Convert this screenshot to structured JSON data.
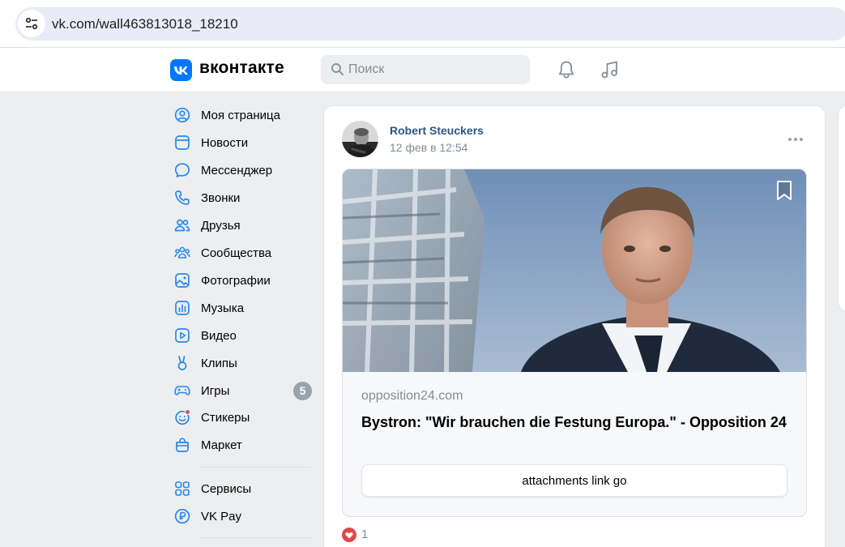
{
  "browser": {
    "url": "vk.com/wall463813018_18210",
    "site_info_icon": "tune-icon"
  },
  "header": {
    "logo_text": "вконтакте",
    "search_placeholder": "Поиск",
    "icons": [
      "bell-icon",
      "music-icon"
    ],
    "accent_color": "#0077ff"
  },
  "sidebar": {
    "items": [
      {
        "label": "Моя страница",
        "icon": "user-circle-icon"
      },
      {
        "label": "Новости",
        "icon": "news-icon"
      },
      {
        "label": "Мессенджер",
        "icon": "message-icon"
      },
      {
        "label": "Звонки",
        "icon": "phone-icon"
      },
      {
        "label": "Друзья",
        "icon": "friends-icon"
      },
      {
        "label": "Сообщества",
        "icon": "communities-icon"
      },
      {
        "label": "Фотографии",
        "icon": "photo-icon"
      },
      {
        "label": "Музыка",
        "icon": "music-note-icon"
      },
      {
        "label": "Видео",
        "icon": "video-icon"
      },
      {
        "label": "Клипы",
        "icon": "clips-icon"
      },
      {
        "label": "Игры",
        "icon": "gamepad-icon",
        "badge": "5"
      },
      {
        "label": "Стикеры",
        "icon": "sticker-icon"
      },
      {
        "label": "Маркет",
        "icon": "market-icon"
      },
      {
        "label": "Сервисы",
        "icon": "services-icon"
      },
      {
        "label": "VK Pay",
        "icon": "vkpay-icon"
      }
    ]
  },
  "post": {
    "author": "Robert Steuckers",
    "date": "12 фев в 12:54",
    "link_snippet": {
      "domain": "opposition24.com",
      "title": "Bystron: \"Wir brauchen die Festung Europa.\" - Opposition 24",
      "button_label": "attachments link go"
    },
    "likes": "1",
    "link_color": "#2a5885",
    "like_color": "#e64646"
  }
}
